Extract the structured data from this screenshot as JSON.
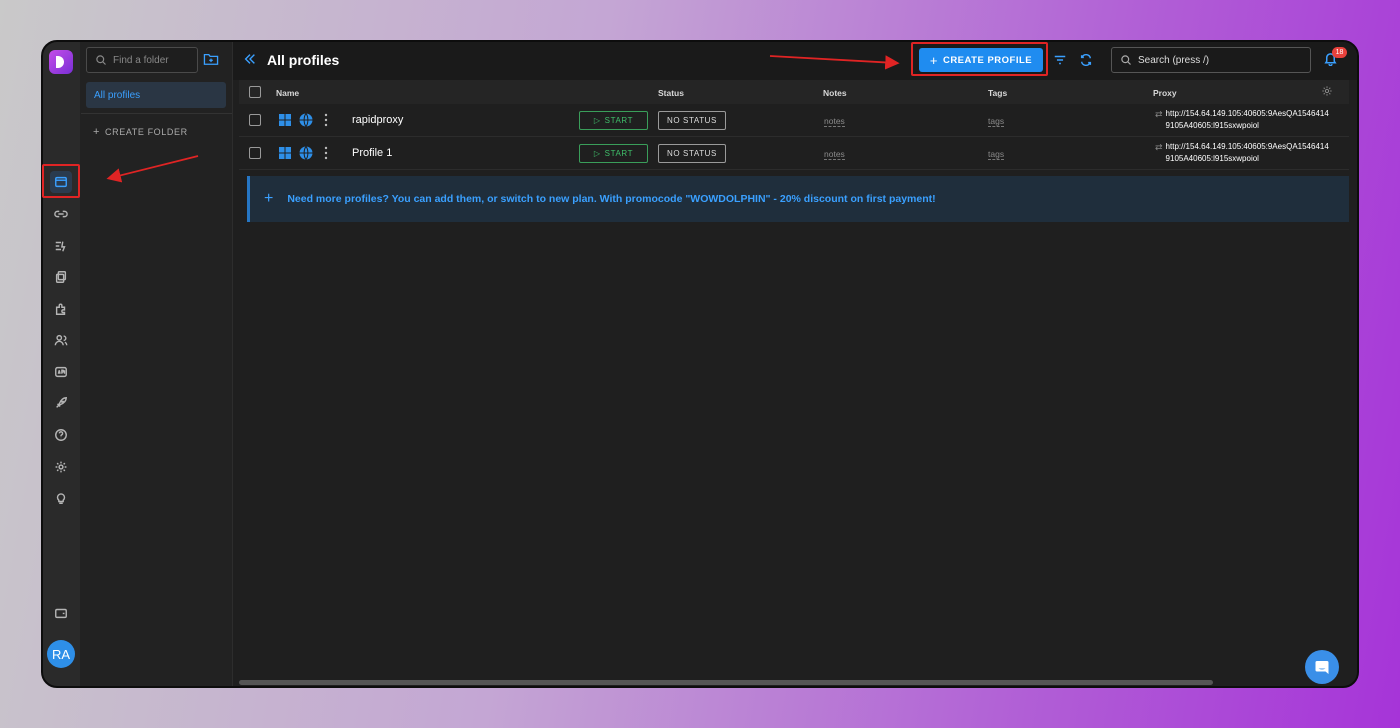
{
  "sidebar": {
    "folder_search_placeholder": "Find a folder",
    "folders": [
      "All profiles"
    ],
    "create_folder_label": "CREATE FOLDER",
    "rail_icons": [
      "browser-profiles-icon",
      "proxy-link-icon",
      "automation-icon",
      "copy-icon",
      "extensions-icon",
      "users-icon",
      "api-icon",
      "rocket-icon",
      "help-icon",
      "settings-icon",
      "lightbulb-icon",
      "wallet-icon"
    ],
    "avatar_initials": "RA"
  },
  "header": {
    "title": "All profiles",
    "create_profile_label": "CREATE PROFILE",
    "search_placeholder": "Search (press /)",
    "notification_count": "18"
  },
  "table": {
    "columns": [
      "Name",
      "Status",
      "Notes",
      "Tags",
      "Proxy"
    ],
    "start_label": "START",
    "status_label": "NO STATUS",
    "notes_placeholder": "notes",
    "tags_placeholder": "tags",
    "rows": [
      {
        "name": "rapidproxy",
        "proxy_line1": "http://154.64.149.105:40605:9AesQA1546414",
        "proxy_line2": "9105A40605:l915sxwpoiol"
      },
      {
        "name": "Profile 1",
        "proxy_line1": "http://154.64.149.105:40605:9AesQA1546414",
        "proxy_line2": "9105A40605:l915sxwpoiol"
      }
    ]
  },
  "promo": {
    "text": "Need more profiles? You can add them, or switch to new plan. With promocode \"WOWDOLPHIN\" - 20% discount on first payment!"
  },
  "colors": {
    "accent": "#1f8cf0",
    "annotation": "#e02424"
  }
}
